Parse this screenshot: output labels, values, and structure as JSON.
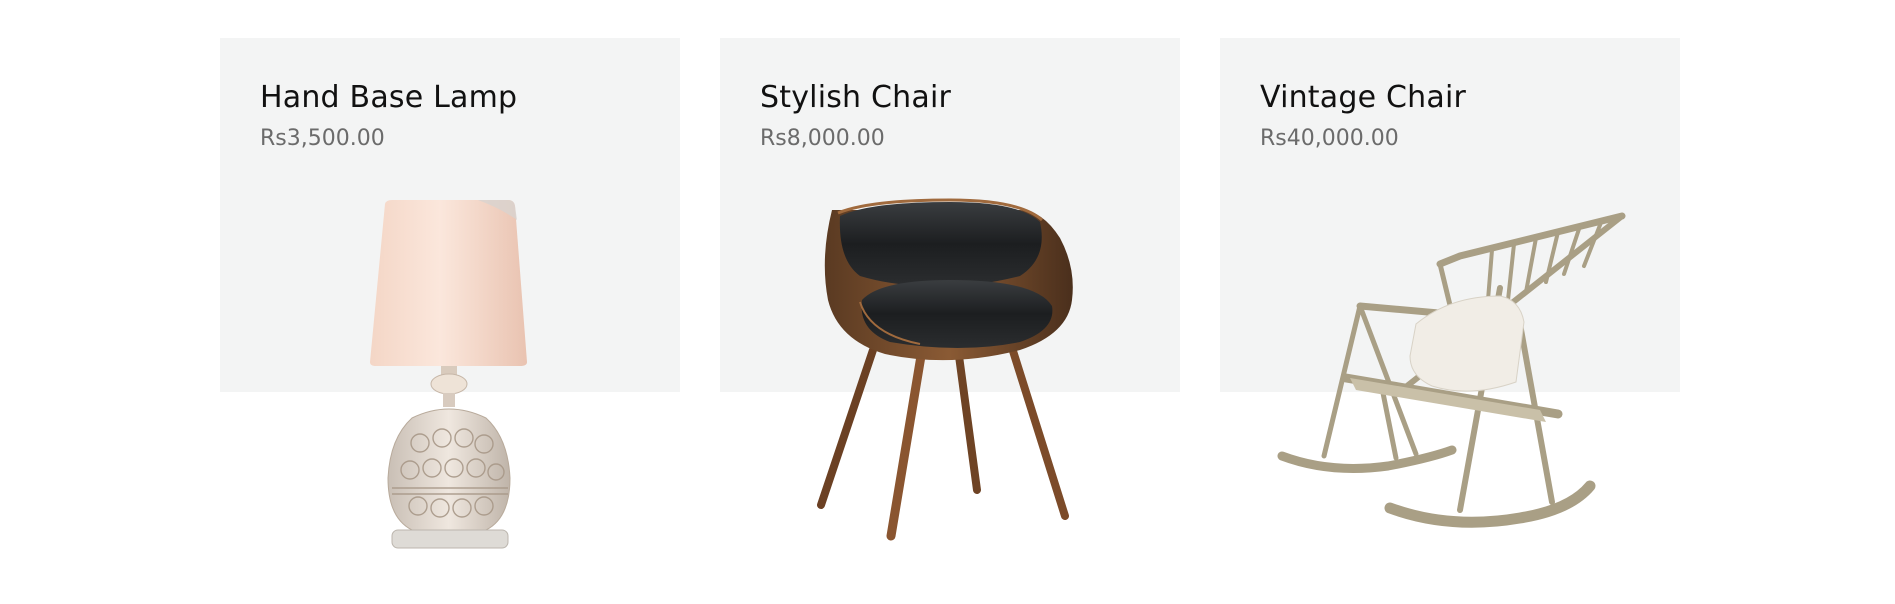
{
  "products": [
    {
      "name": "Hand Base Lamp",
      "price": "Rs3,500.00",
      "image_icon": "table-lamp-icon"
    },
    {
      "name": "Stylish Chair",
      "price": "Rs8,000.00",
      "image_icon": "armchair-icon"
    },
    {
      "name": "Vintage Chair",
      "price": "Rs40,000.00",
      "image_icon": "rocking-chair-icon"
    }
  ],
  "colors": {
    "card_background": "#f3f4f4",
    "title_text": "#111111",
    "price_text": "#6b6b6b"
  }
}
